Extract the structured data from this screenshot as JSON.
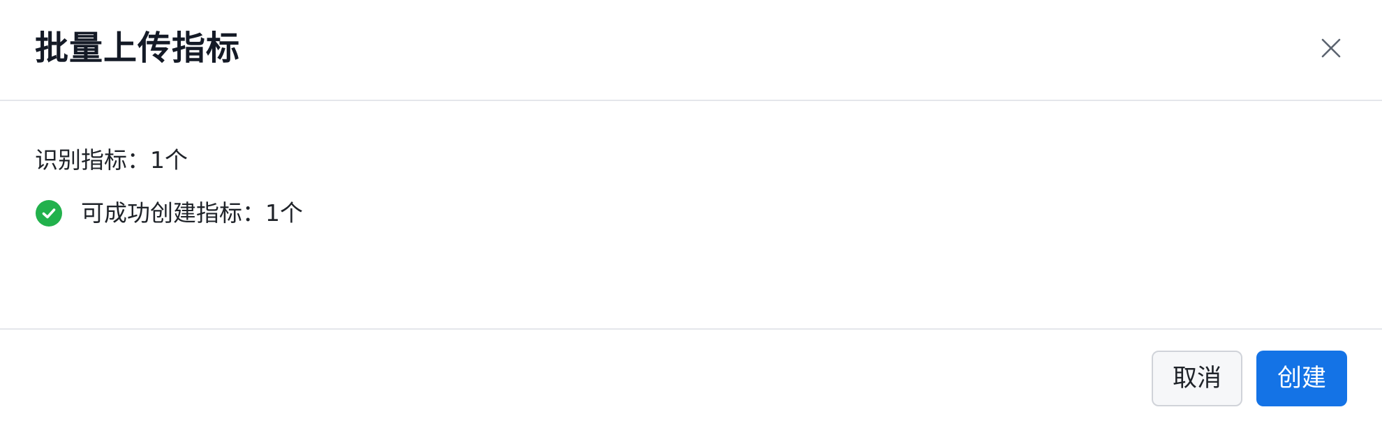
{
  "dialog": {
    "title": "批量上传指标",
    "close_icon": "close-icon"
  },
  "summary": {
    "recognized_label": "识别指标：1个",
    "success_label": "可成功创建指标：1个",
    "success_icon": "check-circle-icon",
    "success_color": "#22b14c"
  },
  "footer": {
    "cancel_label": "取消",
    "create_label": "创建",
    "primary_color": "#1473e6"
  }
}
